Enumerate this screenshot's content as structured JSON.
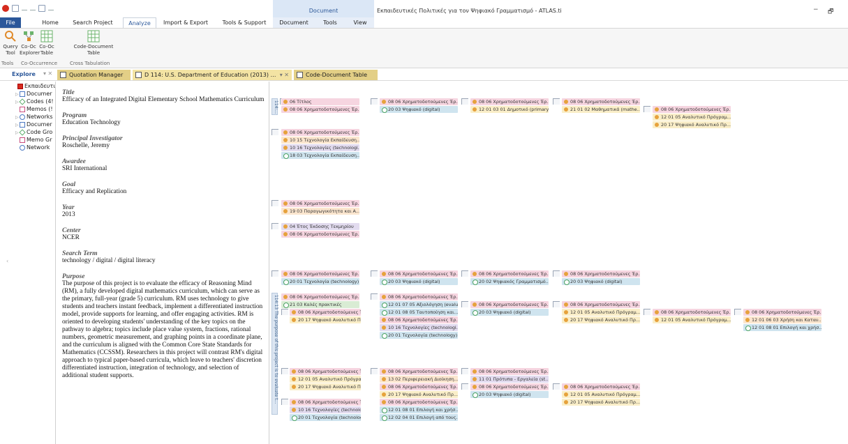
{
  "window": {
    "title": "Εκπαιδευτικές Πολιτικές για τον Ψηφιακό Γραμματισμό - ATLAS.ti",
    "context_group": "Document",
    "controls": [
      "−",
      "🗗"
    ]
  },
  "ribbon_tabs": [
    "File",
    "Home",
    "Search Project",
    "Analyze",
    "Import & Export",
    "Tools & Support"
  ],
  "context_tabs": [
    "Document",
    "Tools",
    "View"
  ],
  "ribbon": {
    "items": [
      {
        "label": "Query\nTool",
        "icon": "query-tool-icon"
      },
      {
        "label": "Co-Oc\nExplorer",
        "icon": "cooc-explorer-icon"
      },
      {
        "label": "Co-Oc\nTable",
        "icon": "cooc-table-icon"
      },
      {
        "label": "Code-Document\nTable",
        "icon": "code-document-table-icon"
      }
    ],
    "groups": [
      "Tools",
      "Co-Occurrence",
      "Cross Tabulation"
    ]
  },
  "panes": {
    "explore_label": "Explore",
    "tabs": [
      {
        "label": "Quotation Manager"
      },
      {
        "label": "D 114: U.S. Department of Education (2013) Efficacy of..."
      },
      {
        "label": "Code-Document Table"
      }
    ]
  },
  "explore_tree": [
    {
      "label": "Εκπαιδευτι",
      "icon": "project-icon"
    },
    {
      "label": "Documer",
      "icon": "document-icon"
    },
    {
      "label": "Codes (4!",
      "icon": "code-icon"
    },
    {
      "label": "Memos (!",
      "icon": "memo-icon"
    },
    {
      "label": "Networks",
      "icon": "network-icon"
    },
    {
      "label": "Documer",
      "icon": "document-group-icon"
    },
    {
      "label": "Code Gro",
      "icon": "code-group-icon"
    },
    {
      "label": "Memo Gr",
      "icon": "memo-group-icon"
    },
    {
      "label": "Network",
      "icon": "network-group-icon"
    }
  ],
  "document": {
    "sections": [
      {
        "heading": "Title",
        "value": "Efficacy of an Integrated Digital Elementary School Mathematics Curriculum"
      },
      {
        "heading": "Program",
        "value": "Education Technology"
      },
      {
        "heading": "Principal Investigator",
        "value": "Roschelle, Jeremy"
      },
      {
        "heading": "Awardee",
        "value": "SRI International"
      },
      {
        "heading": "Goal",
        "value": "Efficacy and Replication"
      },
      {
        "heading": "Year",
        "value": "2013"
      },
      {
        "heading": "Center",
        "value": "NCER"
      },
      {
        "heading": "Search Term",
        "value": "technology / digital / digital literacy"
      },
      {
        "heading": "Purpose",
        "value": "The purpose of this project is to evaluate the efficacy of Reasoning Mind (RM), a fully developed digital mathematics curriculum, which can serve as the primary, full-year (grade 5) curriculum. RM uses technology to give students and teachers instant feedback, implement a differentiated instruction model, provide supports for learning, and offer engaging activities. RM is oriented to developing students' understanding of the key topics on the pathway to algebra; topics include place value system, fractions, rational numbers, geometric measurement, and graphing points in a coordinate plane, and the curriculum is aligned with the Common Core State Standards for Mathematics (CCSSM). Researchers in this project will contrast RM's digital approach to typical paper-based curricula, which leave to teachers' discretion differentiated instruction, integration of technology, and selection of additional student supports."
      }
    ]
  },
  "margin": {
    "bars": [
      {
        "label": "114:..."
      },
      {
        "label": "114:13 The purpose of this project is to evaluate t..."
      }
    ],
    "codes": [
      "06 Τίτλος",
      "08 06 Χρηματοδοτούμενες Έρ...",
      "08 06 Χρηματοδοτούμενες Έρ...",
      "20 03 Ψηφιακό (digital)",
      "08 06 Χρηματοδοτούμενες Έρ...",
      "12 01 03 01 Δημοτικό (primary)",
      "08 06 Χρηματοδοτούμενες Έρ...",
      "21 01 02 Μαθηματικά (mathe...",
      "08 06 Χρηματοδοτούμενες Έρ...",
      "12 01 05 Αναλυτικό Πρόγραμ...",
      "20 17 Ψηφιακό Αναλυτικό Πρ...",
      "08 06 Χρηματοδοτούμενες Έρ...",
      "10 15 Τεχνολογία Εκπαίδευση...",
      "10 16 Τεχνολογίες (technologi...",
      "18 03 Τεχνολογία Εκπαίδευση...",
      "08 06 Χρηματοδοτούμενες Έρ...",
      "19 03 Παραγωγικότητα και Α...",
      "04 Έτος Έκδοσης Τεκμηρίου",
      "08 06 Χρηματοδοτούμενες Έρ...",
      "08 06 Χρηματοδοτούμενες Έρ...",
      "20 01 Τεχνολογία (technology)",
      "08 06 Χρηματοδοτούμενες Έρ...",
      "20 03 Ψηφιακό (digital)",
      "08 06 Χρηματοδοτούμενες Έρ...",
      "20 02 Ψηφιακός Γραμματισμό...",
      "08 06 Χρηματοδοτούμενες Έρ...",
      "20 03 Ψηφιακό (digital)",
      "08 06 Χρηματοδοτούμενες Έρ...",
      "21 03 Καλές πρακτικές",
      "08 06 Χρηματοδοτούμενες Έρ...",
      "20 17 Ψηφιακό Αναλυτικό Πρ...",
      "08 06 Χρηματοδοτούμενες Έρ...",
      "12 01 07 05 Αξιολόγηση (evalu...",
      "12 01 08 05 Ταυτοποίηση και...",
      "08 06 Χρηματοδοτούμενες Έρ...",
      "10 16 Τεχνολογίες (technologi...",
      "20 01 Τεχνολογία (technology)",
      "08 06 Χρηματοδοτούμενες Έρ...",
      "20 03 Ψηφιακό (digital)",
      "08 06 Χρηματοδοτούμενες Έρ...",
      "12 01 05 Αναλυτικό Πρόγραμ...",
      "20 17 Ψηφιακό Αναλυτικό Πρ...",
      "08 06 Χρηματοδοτούμενες Έρ...",
      "12 01 05 Αναλυτικό Πρόγραμ...",
      "08 06 Χρηματοδοτούμενες Έρ...",
      "12 01 06 03 Χρήση και Καταυ...",
      "12 01 08 01 Επιλογή και χρήσ...",
      "08 06 Χρηματοδοτούμενες Έρ...",
      "12 01 05 Αναλυτικό Πρόγραμ...",
      "20 17 Ψηφιακό Αναλυτικό Πρ...",
      "08 06 Χρηματοδοτούμενες Έρ...",
      "13 02 Περιφερειακή Διοίκηση...",
      "08 06 Χρηματοδοτούμενες Έρ...",
      "20 17 Ψηφιακό Αναλυτικό Πρ...",
      "08 06 Χρηματοδοτούμενες Έρ...",
      "11 01 Πρότυπα - Εργαλεία (st...",
      "08 06 Χρηματοδοτούμενες Έρ...",
      "20 03 Ψηφιακό (digital)",
      "08 06 Χρηματοδοτούμενες Έρ...",
      "12 01 05 Αναλυτικό Πρόγραμ...",
      "20 17 Ψηφιακό Αναλυτικό Πρ...",
      "08 06 Χρηματοδοτούμενες Έρ...",
      "10 16 Τεχνολογίες (technologi...",
      "20 01 Τεχνολογία (technology)",
      "08 06 Χρηματοδοτούμενες Έρ...",
      "12 01 08 01 Επιλογή και χρήσ...",
      "12 02 04 01 Επιλογή από τους..."
    ]
  },
  "colors": {
    "accent": "#2b579a",
    "file_tab": "#2b579a",
    "pane_tab": "#e3cf86",
    "code_pink": "#f6d5e0",
    "code_blue": "#cfe4ef",
    "code_yellow": "#faeec8",
    "code_orange": "#fbe6cf",
    "code_lavender": "#e2dbef",
    "code_green": "#d9ecd4"
  }
}
